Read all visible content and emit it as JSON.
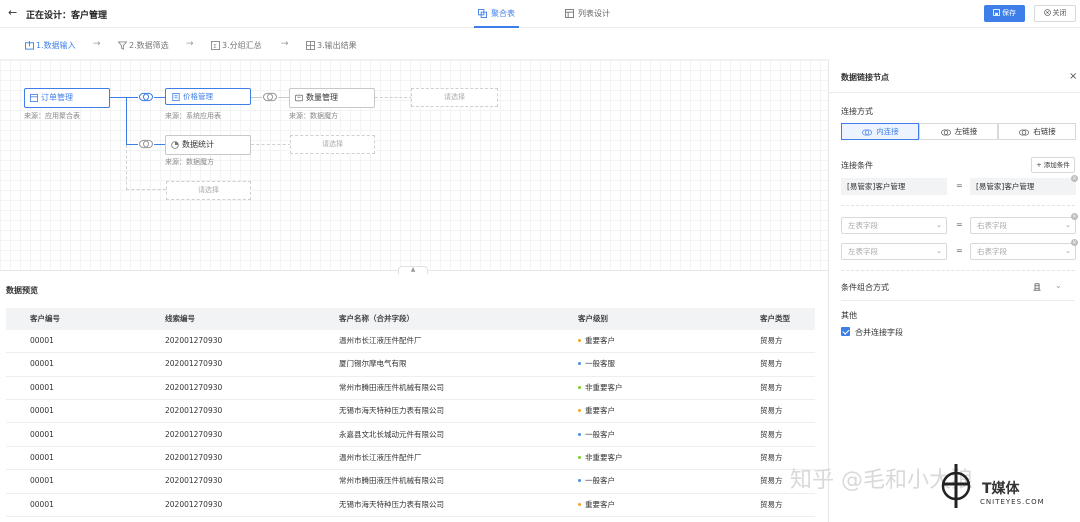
{
  "header": {
    "title": "正在设计：客户管理",
    "tabs": [
      {
        "label": "聚合表",
        "active": true
      },
      {
        "label": "列表设计",
        "active": false
      }
    ],
    "save_label": "保存",
    "close_label": "关闭"
  },
  "steps": [
    "1.数据输入",
    "2.数据筛选",
    "3.分组汇总",
    "3.输出结果"
  ],
  "canvas": {
    "nodes": [
      {
        "label": "订单管理",
        "source": "来源：应用聚合表"
      },
      {
        "label": "价格管理",
        "source": "来源：系统应用表"
      },
      {
        "label": "数量管理",
        "source": "来源：数据魔方"
      },
      {
        "label": "数据统计",
        "source": "来源：数据魔方"
      }
    ],
    "placeholder": "请选择"
  },
  "preview": {
    "title": "数据预览",
    "columns": [
      "客户编号",
      "线索编号",
      "客户名称（合并字段）",
      "客户级别",
      "客户类型"
    ],
    "rows": [
      [
        "00001",
        "202001270930",
        "温州市长江液压件配件厂",
        "重要客户",
        "贸易方"
      ],
      [
        "00001",
        "202001270930",
        "厦门锡尔摩电气有限",
        "一般客服",
        "贸易方"
      ],
      [
        "00001",
        "202001270930",
        "常州市腾田液压件机械有限公司",
        "非重要客户",
        "贸易方"
      ],
      [
        "00001",
        "202001270930",
        "无锡市海天特种压力表有限公司",
        "重要客户",
        "贸易方"
      ],
      [
        "00001",
        "202001270930",
        "永嘉县文北长城动元件有限公司",
        "一般客户",
        "贸易方"
      ],
      [
        "00001",
        "202001270930",
        "温州市长江液压件配件厂",
        "非重要客户",
        "贸易方"
      ],
      [
        "00001",
        "202001270930",
        "常州市腾田液压件机械有限公司",
        "一般客户",
        "贸易方"
      ],
      [
        "00001",
        "202001270930",
        "无锡市海天特种压力表有限公司",
        "重要客户",
        "贸易方"
      ]
    ],
    "level_colors": {
      "重要客户": "#f5a623",
      "一般客服": "#4a90e2",
      "非重要客户": "#7ed321",
      "一般客户": "#4a90e2"
    }
  },
  "panel": {
    "title": "数据链接节点",
    "join_label": "连接方式",
    "join_types": [
      "内连接",
      "左链接",
      "右链接"
    ],
    "condition_label": "连接条件",
    "add_condition": "添加条件",
    "conditions": [
      {
        "left": "[易管家]客户管理",
        "op": "=",
        "right": "[易管家]客户管理"
      },
      {
        "left": "左表字段",
        "op": "=",
        "right": "右表字段"
      },
      {
        "left": "左表字段",
        "op": "=",
        "right": "右表字段"
      }
    ],
    "combine_label": "条件组合方式",
    "combine_value": "且",
    "other_label": "其他",
    "merge_label": "合并连接字段"
  },
  "watermark": {
    "text": "知乎 @毛和小大狼",
    "brand": "T媒体",
    "brand_sub": "CNITEYES.COM"
  },
  "accent_color": "#3e7ee8"
}
